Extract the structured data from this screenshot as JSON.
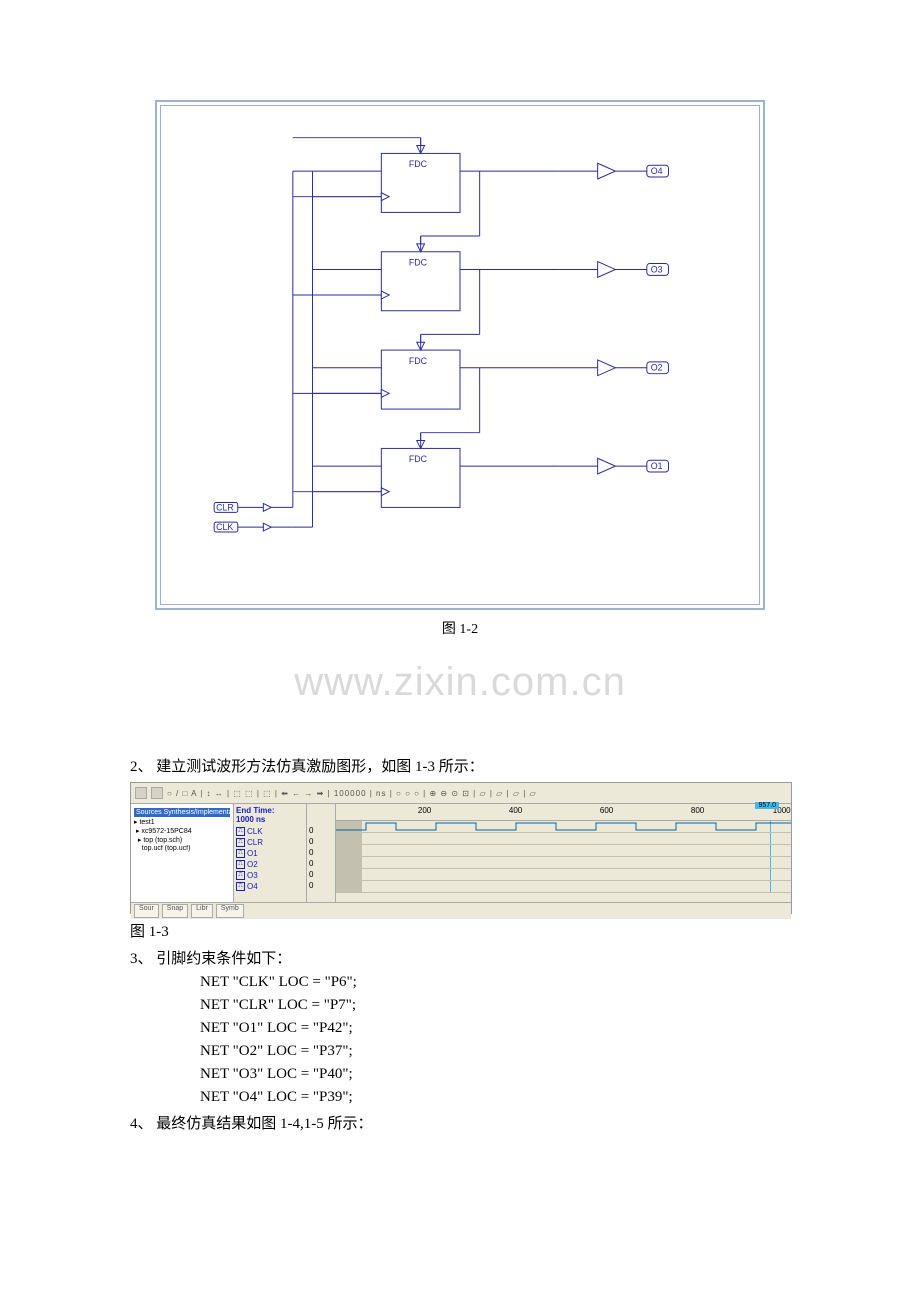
{
  "schematic": {
    "block_label": "FDC",
    "inputs": {
      "clr_label": "CLR",
      "clk_label": "CLK"
    },
    "outputs": {
      "o1": "O1",
      "o2": "O2",
      "o3": "O3",
      "o4": "O4"
    }
  },
  "caption_1_2": "图 1-2",
  "watermark": "www.zixin.com.cn",
  "section2_text": "2、 建立测试波形方法仿真激励图形，如图 1-3 所示：",
  "waveform": {
    "toolbar_hint": "○ / □ A | ↕ ↔ | ⬚ ⬚ | ⬚ | ⬅ ← → ➡ | 100000 | ns | ○ ○ ○ | ⊕ ⊖ ⊙ ⊡ | ▱ | ▱ | ▱ | ▱",
    "tree_header": "Sources  Synthesis/Implementa",
    "tree_items": [
      "test1",
      "xc9572-15PC84",
      "top (top.sch)",
      "top.ucf (top.ucf)"
    ],
    "end_time_label": "End Time:",
    "end_time_value": "1000 ns",
    "signals": [
      "CLK",
      "CLR",
      "O1",
      "O2",
      "O3",
      "O4"
    ],
    "values": [
      "0",
      "0",
      "0",
      "0",
      "0",
      "0"
    ],
    "ruler": [
      "200",
      "400",
      "600",
      "800",
      "1000"
    ],
    "ruler_marker": "957.0",
    "tabs": [
      "Sour",
      "Snap",
      "Libr",
      "Symb"
    ]
  },
  "caption_1_3": "图 1-3",
  "section3_header": "3、 引脚约束条件如下：",
  "constraints": [
    "NET \"CLK\" LOC = \"P6\";",
    "NET \"CLR\" LOC = \"P7\";",
    "NET \"O1\" LOC = \"P42\";",
    "NET \"O2\" LOC = \"P37\";",
    "NET \"O3\" LOC = \"P40\";",
    "NET \"O4\" LOC = \"P39\";"
  ],
  "section4_text": "4、 最终仿真结果如图 1-4,1-5 所示："
}
